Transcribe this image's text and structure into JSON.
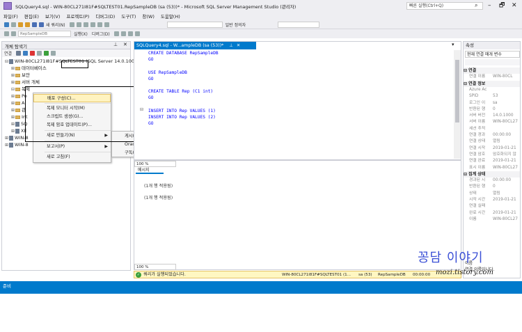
{
  "window": {
    "title": "SQLQuery4.sql - WIN-80CL271I81F#SQLTEST01.RepSampleDB (sa (53))* - Microsoft SQL Server Management Studio (관리자)",
    "quick_launch_placeholder": "빠른 실행(Ctrl+Q)",
    "minimize": "–",
    "maximize": "🗗",
    "close": "✕"
  },
  "menu": [
    "파일(F)",
    "편집(E)",
    "보기(V)",
    "프로젝트(P)",
    "디버그(D)",
    "도구(T)",
    "창(W)",
    "도움말(H)"
  ],
  "toolbar": {
    "new_query": "새 쿼리(N)",
    "database_combo": "RepSampleDB",
    "execute": "실행(X)",
    "debug": "디버그(D)",
    "solution_platform": "일반 정의자"
  },
  "object_explorer": {
    "title": "개체 탐색기",
    "connect": "연결",
    "tree": [
      {
        "label": "WIN-80CL271I81F#SQLTEST01 (SQL Server 14.0.100",
        "exp": "⊟",
        "level": 0,
        "kind": "server"
      },
      {
        "label": "데이터베이스",
        "exp": "⊞",
        "level": 1,
        "kind": "folder"
      },
      {
        "label": "보안",
        "exp": "⊞",
        "level": 1,
        "kind": "folder"
      },
      {
        "label": "서버 개체",
        "exp": "⊞",
        "level": 1,
        "kind": "folder"
      },
      {
        "label": "복제",
        "exp": "⊟",
        "level": 1,
        "kind": "folder"
      },
      {
        "label": "Po",
        "exp": "⊞",
        "level": 1,
        "kind": "folder"
      },
      {
        "label": "Al",
        "exp": "⊞",
        "level": 1,
        "kind": "folder"
      },
      {
        "label": "관",
        "exp": "⊞",
        "level": 1,
        "kind": "folder"
      },
      {
        "label": "Int",
        "exp": "⊞",
        "level": 1,
        "kind": "folder"
      },
      {
        "label": "SQ",
        "exp": "⊞",
        "level": 1,
        "kind": "server"
      },
      {
        "label": "XE",
        "exp": "⊞",
        "level": 1,
        "kind": "server"
      },
      {
        "label": "WIN-8",
        "exp": "⊞",
        "level": 0,
        "kind": "server"
      },
      {
        "label": "WIN-8",
        "exp": "⊞",
        "level": 0,
        "kind": "server"
      }
    ]
  },
  "context_menu": {
    "items": [
      "배포 구성(C)...",
      "복제 모니터 시작(M)",
      "스크립트 생성(G)...",
      "복제 암호 업데이트(P)...",
      "새로 만들기(N)",
      "보고서(P)",
      "새로 고침(F)"
    ]
  },
  "submenu": {
    "items": [
      "게시(P)...",
      "Oracle 게시(O)...",
      "구독(S)..."
    ]
  },
  "editor": {
    "tab": "SQLQuery4.sql - W...ampleDB (sa (53))*",
    "lines": [
      "CREATE DATABASE RepSampleDB",
      "GO",
      "",
      "USE RepSampleDB",
      "GO",
      "",
      "CREATE TABLE Rep (C1 int)",
      "GO",
      "",
      "INSERT INTO Rep VALUES (1)",
      "INSERT INTO Rep VALUES (2)",
      "GO"
    ],
    "zoom": "100 %"
  },
  "results": {
    "tab": "메시지",
    "messages": [
      "(1개 행 적용됨)",
      "(1개 행 적용됨)"
    ],
    "zoom": "100 %"
  },
  "query_status": {
    "text": "쿼리가 실행되었습니다.",
    "server": "WIN-80CL271I81F#SQLTEST01 (1...",
    "user": "sa (53)",
    "database": "RepSampleDB",
    "elapsed": "00:00:00"
  },
  "properties": {
    "title": "속성",
    "combo": "현재 연결 매개 변수",
    "rows": [
      {
        "type": "cat",
        "k": "⊟ 연결"
      },
      {
        "type": "row",
        "k": "연결 이름",
        "v": "WIN-80CL"
      },
      {
        "type": "cat",
        "k": "⊟ 연결 정보"
      },
      {
        "type": "row",
        "k": "Azure Ac",
        "v": ""
      },
      {
        "type": "row",
        "k": "SPID",
        "v": "53"
      },
      {
        "type": "row",
        "k": "로그인 이",
        "v": "sa"
      },
      {
        "type": "row",
        "k": "반환된 행",
        "v": "0"
      },
      {
        "type": "row",
        "k": "서버 버전",
        "v": "14.0.1000"
      },
      {
        "type": "row",
        "k": "서버 이름",
        "v": "WIN-80CL27"
      },
      {
        "type": "row",
        "k": "세션 추적",
        "v": ""
      },
      {
        "type": "row",
        "k": "연결 경과",
        "v": "00:00:00"
      },
      {
        "type": "row",
        "k": "연결 상태",
        "v": "열림"
      },
      {
        "type": "row",
        "k": "연결 시작",
        "v": "2019-01-21"
      },
      {
        "type": "row",
        "k": "연결 암호",
        "v": "암호화되지 않"
      },
      {
        "type": "row",
        "k": "연결 완료",
        "v": "2019-01-21"
      },
      {
        "type": "row",
        "k": "표시 이름",
        "v": "WIN-80CL27"
      },
      {
        "type": "cat",
        "k": "⊟ 집계 상태"
      },
      {
        "type": "row",
        "k": "경과된 시",
        "v": "00:00:00"
      },
      {
        "type": "row",
        "k": "반환된 행",
        "v": "0"
      },
      {
        "type": "row",
        "k": "상태",
        "v": "열림"
      },
      {
        "type": "row",
        "k": "시작 시간",
        "v": "2019-01-21"
      },
      {
        "type": "row",
        "k": "연결 실패",
        "v": ""
      },
      {
        "type": "row",
        "k": "완료 시간",
        "v": "2019-01-21"
      },
      {
        "type": "row",
        "k": "이름",
        "v": "WIN-80CL27"
      }
    ],
    "desc_title": "이름",
    "desc_text": "연결 이름입니다."
  },
  "statusbar": {
    "text": "준비"
  },
  "watermark": {
    "title": "꽁담 이야기",
    "url": "mozi.tistory.com"
  },
  "colors": {
    "accent": "#007acc",
    "highlight": "#fff3c0"
  }
}
